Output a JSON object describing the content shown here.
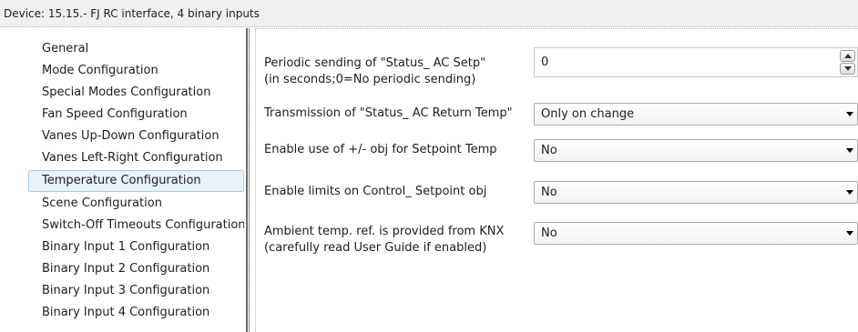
{
  "device_title": "Device: 15.15.-  FJ RC interface, 4 binary inputs",
  "sidebar": {
    "items": [
      {
        "label": "General"
      },
      {
        "label": "Mode Configuration"
      },
      {
        "label": "Special Modes Configuration"
      },
      {
        "label": "Fan Speed Configuration"
      },
      {
        "label": "Vanes Up-Down Configuration"
      },
      {
        "label": "Vanes Left-Right Configuration"
      },
      {
        "label": "Temperature Configuration"
      },
      {
        "label": "Scene Configuration"
      },
      {
        "label": "Switch-Off Timeouts Configuration"
      },
      {
        "label": "Binary Input 1 Configuration"
      },
      {
        "label": "Binary Input 2 Configuration"
      },
      {
        "label": "Binary Input 3 Configuration"
      },
      {
        "label": "Binary Input 4 Configuration"
      }
    ],
    "selected": "Temperature Configuration"
  },
  "params": {
    "periodic_sending": {
      "label_line1": "Periodic sending of \"Status_ AC Setp\"",
      "label_line2": "(in seconds;0=No periodic sending)",
      "value": "0",
      "icons": [
        "spin-up-icon",
        "spin-down-icon"
      ]
    },
    "transmission": {
      "label": "Transmission of \"Status_ AC Return Temp\"",
      "value": "Only on change"
    },
    "enable_plus_minus": {
      "label": "Enable use of +/- obj for Setpoint Temp",
      "value": "No"
    },
    "enable_limits": {
      "label": "Enable limits on Control_ Setpoint obj",
      "value": "No"
    },
    "ambient_temp": {
      "label_line1": "Ambient temp. ref. is provided from KNX",
      "label_line2": "(carefully read User Guide if enabled)",
      "value": "No"
    }
  },
  "icons": {
    "dropdown": "chevron-down-icon"
  },
  "colors": {
    "selection_bg": "#e9f2fb",
    "selection_border": "#a9cdf0",
    "header_bg": "#f0f0f0"
  }
}
